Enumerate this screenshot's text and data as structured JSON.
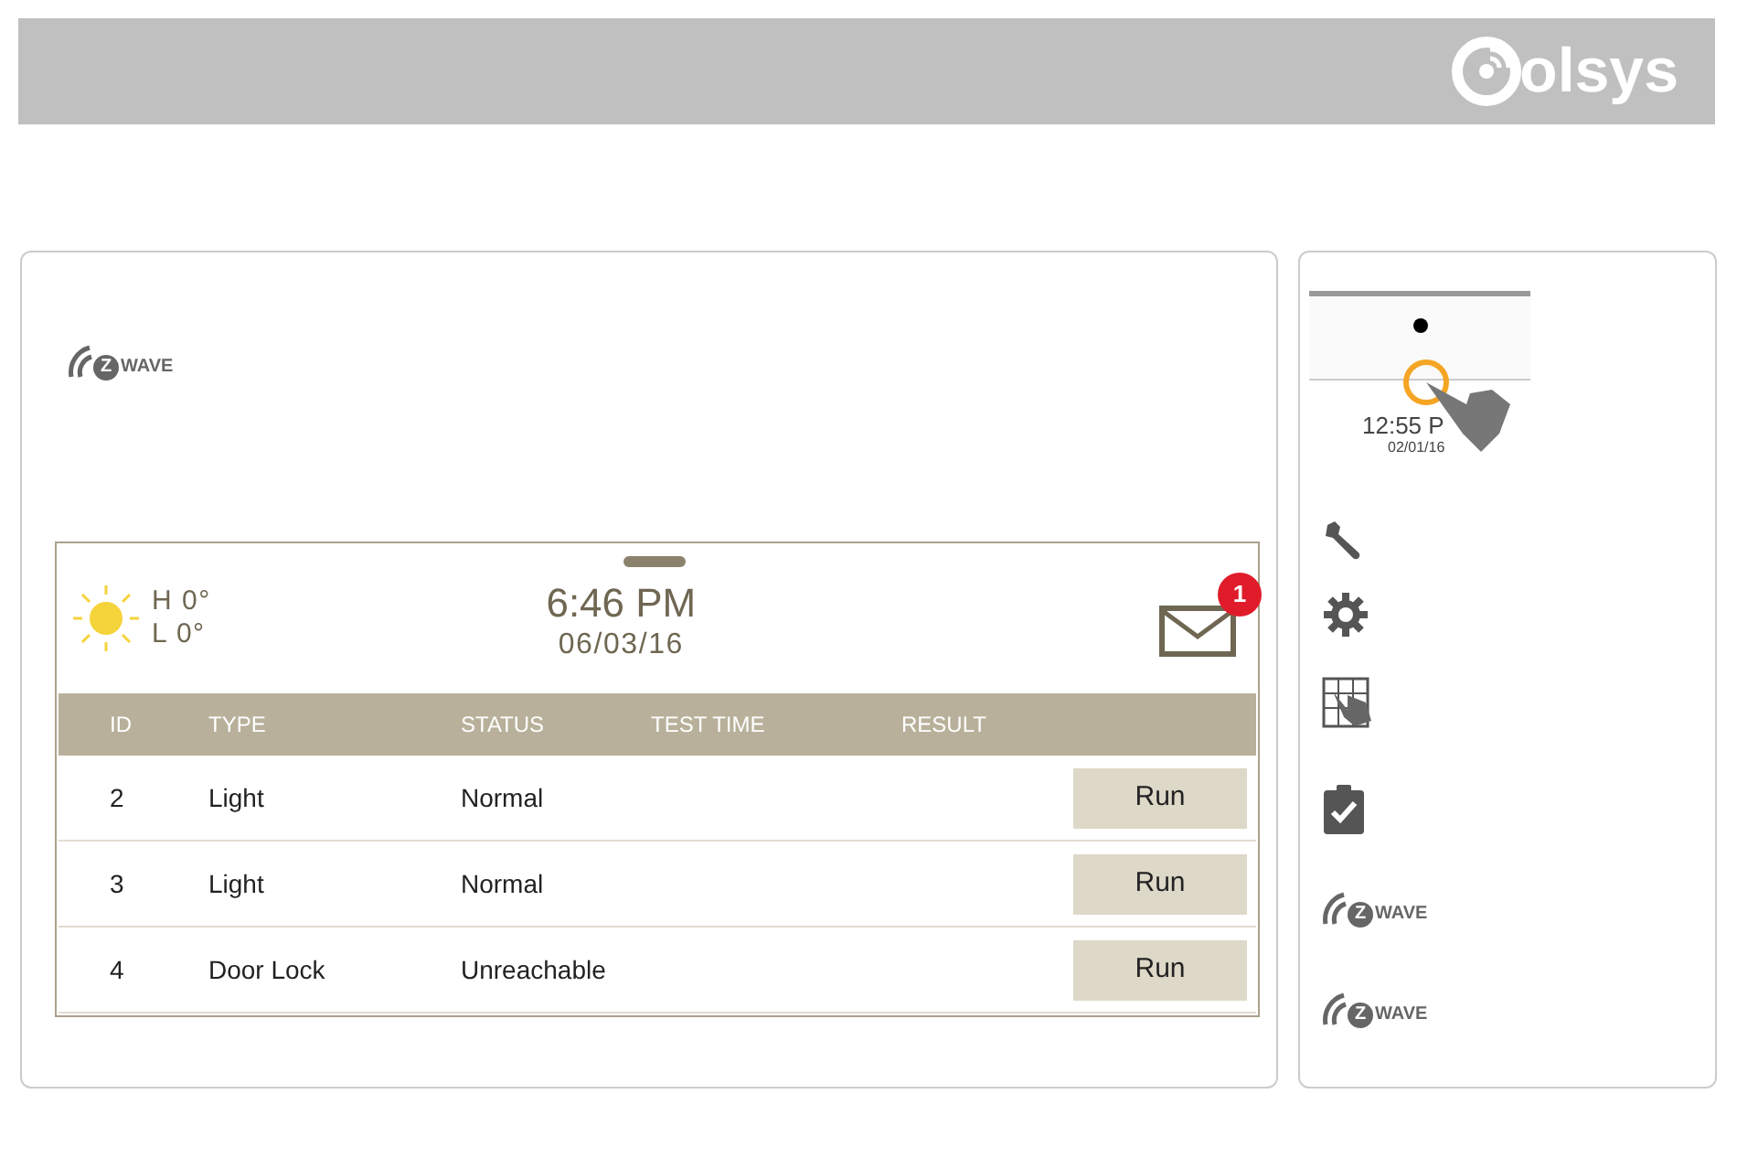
{
  "header": {
    "logo_text": "olsys"
  },
  "main_panel": {
    "logo": {
      "mark": "Z",
      "word": "WAVE"
    },
    "screen": {
      "weather": {
        "high": "H 0°",
        "low": "L 0°"
      },
      "time": "6:46 PM",
      "date": "06/03/16",
      "message_count": "1",
      "table": {
        "columns": [
          "ID",
          "TYPE",
          "STATUS",
          "TEST TIME",
          "RESULT"
        ],
        "rows": [
          {
            "id": "2",
            "type": "Light",
            "status": "Normal",
            "action": "Run"
          },
          {
            "id": "3",
            "type": "Light",
            "status": "Normal",
            "action": "Run"
          },
          {
            "id": "4",
            "type": "Door Lock",
            "status": "Unreachable",
            "action": "Run"
          }
        ]
      }
    }
  },
  "side_panel": {
    "preview": {
      "time": "12:55 P",
      "date": "02/01/16"
    },
    "icons": [
      {
        "kind": "wrench"
      },
      {
        "kind": "gear"
      },
      {
        "kind": "keypad"
      },
      {
        "kind": "clipboard"
      },
      {
        "kind": "zwave",
        "mark": "Z",
        "word": "WAVE"
      },
      {
        "kind": "zwave",
        "mark": "Z",
        "word": "WAVE"
      }
    ]
  }
}
